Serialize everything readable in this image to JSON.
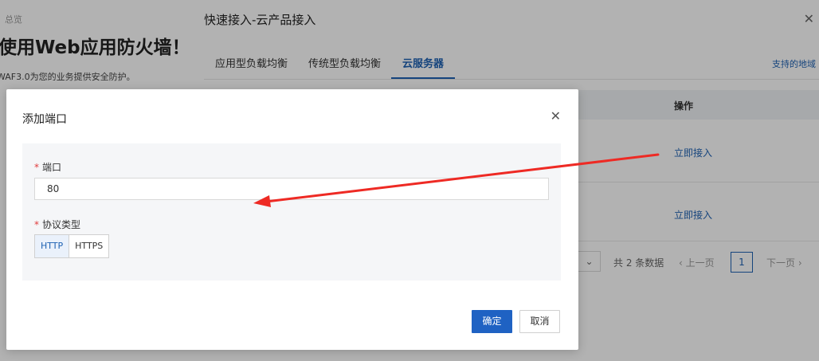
{
  "background_page": {
    "breadcrumb": "总览",
    "title": "使用Web应用防火墙！",
    "description": "WAF3.0为您的业务提供安全防护。"
  },
  "drawer": {
    "title": "快速接入-云产品接入",
    "tabs": [
      {
        "label": "应用型负载均衡",
        "active": false
      },
      {
        "label": "传统型负载均衡",
        "active": false
      },
      {
        "label": "云服务器",
        "active": true
      }
    ],
    "region_link": "支持的地域",
    "table": {
      "header_action": "操作",
      "rows": [
        {
          "action": "立即接入"
        },
        {
          "action": "立即接入"
        }
      ]
    },
    "pagination": {
      "total": "共 2 条数据",
      "prev": "上一页",
      "current": "1",
      "next": "下一页"
    }
  },
  "modal": {
    "title": "添加端口",
    "port_field": {
      "label": "端口",
      "value": "80"
    },
    "protocol_field": {
      "label": "协议类型",
      "options": [
        {
          "label": "HTTP",
          "selected": true
        },
        {
          "label": "HTTPS",
          "selected": false
        }
      ]
    },
    "confirm_label": "确定",
    "cancel_label": "取消"
  },
  "colors": {
    "primary": "#1f62c3",
    "link": "#1f62b3",
    "required": "#e03c3c",
    "annotation_arrow": "#ee2a24"
  }
}
